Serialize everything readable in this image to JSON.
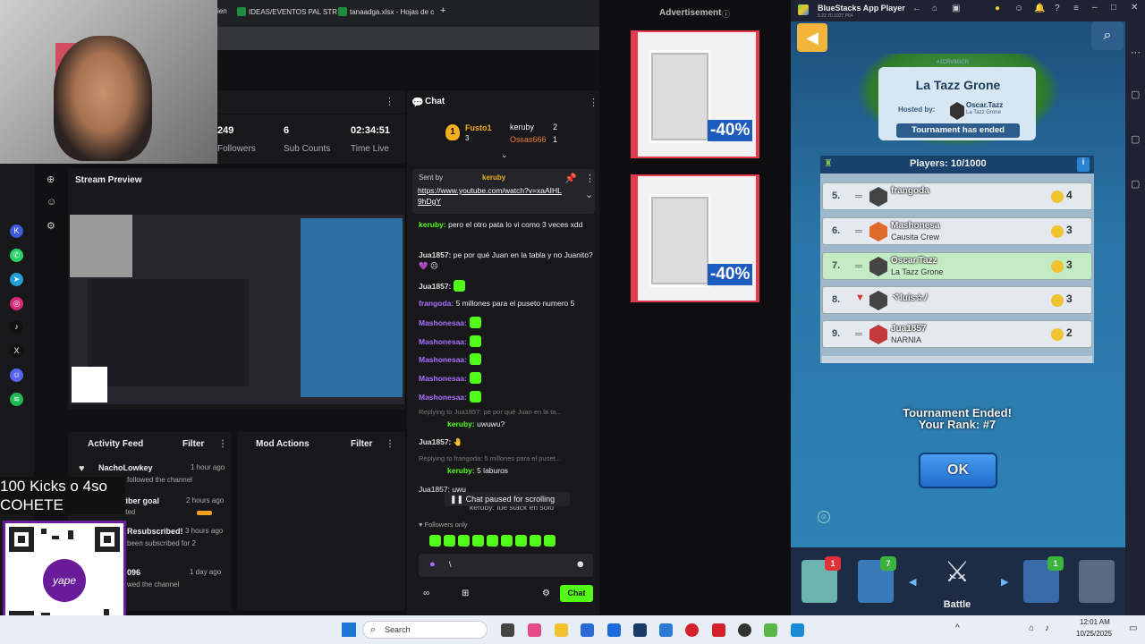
{
  "browser": {
    "tabs": [
      "IDEAS/EVENTOS PAL STR",
      "tanaadga.xlsx - Hojas de c"
    ],
    "partial_tab": "ien"
  },
  "dashboard": {
    "stats": [
      {
        "value": "249",
        "label": "Followers"
      },
      {
        "value": "6",
        "label": "Sub Counts"
      },
      {
        "value": "02:34:51",
        "label": "Time Live"
      }
    ],
    "stream_preview_title": "Stream Preview",
    "activity_title": "Activity Feed",
    "mod_title": "Mod Actions",
    "filter_label": "Filter",
    "feed": [
      {
        "name": "NachoLowkey",
        "time": "1 hour ago",
        "sub": "followed the channel"
      },
      {
        "name": "Subscriber goal",
        "time": "2 hours ago",
        "sub": "Just started"
      },
      {
        "name": "Resubscribed!",
        "time": "3 hours ago",
        "sub": "been subscribed for 2"
      },
      {
        "name": "096",
        "time": "1 day ago",
        "sub": "wed the channel"
      }
    ]
  },
  "overlay": {
    "kicks_line1": "100 Kicks o 4so",
    "kicks_line2": "COHETE"
  },
  "chat": {
    "title": "Chat",
    "top_gifters": [
      {
        "rank": "1",
        "name": "Fusto1",
        "count": "3"
      },
      {
        "name": "keruby",
        "count": "2"
      },
      {
        "name": "Ossas666",
        "count": "1"
      }
    ],
    "pinned_sender": "keruby",
    "pinned_prefix": "Sent by",
    "pinned_link": "https://www.youtube.com/watch?v=xaAIHL9hDgY",
    "messages": [
      {
        "name": "keruby:",
        "text": "pero el otro pata lo vi como 3 veces xdd"
      },
      {
        "name": "Jua1857:",
        "text": "pe por qué Juan en la tabla y no Juanito? 💜 ☹"
      },
      {
        "name": "Jua1857:",
        "text": ""
      },
      {
        "name": "frangoda:",
        "text": "5 millones para el puseto numero 5"
      },
      {
        "name": "Mashonesaa:",
        "text": ""
      },
      {
        "name": "Mashonesaa:",
        "text": ""
      },
      {
        "name": "Mashonesaa:",
        "text": ""
      },
      {
        "name": "Mashonesaa:",
        "text": ""
      },
      {
        "name": "Mashonesaa:",
        "text": ""
      }
    ],
    "reply1": "Replying to Jua1857: pe por qué Juan en la ta...",
    "msg_uwu": {
      "name": "keruby:",
      "text": "uwuwu?"
    },
    "msg_hand": {
      "name": "Jua1857:",
      "text": "🤚"
    },
    "reply2": "Replying to frangoda: 5 millones para el puset...",
    "msg_laburos": {
      "name": "keruby:",
      "text": "5 laburos"
    },
    "partial_msg": "Jua1857: uwu",
    "partial_msg2": "keruby: fue stack en solo",
    "paused": "Chat paused for scrolling",
    "followers_only": "Followers only",
    "input_value": "\\",
    "send_label": "Chat"
  },
  "ad": {
    "label": "Advertisement",
    "discount": "-40%"
  },
  "bluestacks": {
    "title": "BlueStacks App Player",
    "version": "5.22.70.1027  P64",
    "tag": "#2CRV8GCR",
    "tournament_name": "La Tazz Grone",
    "hosted_by_label": "Hosted by:",
    "host_name": "Oscar.Tazz",
    "host_clan": "La Tazz Grone",
    "status": "Tournament has ended",
    "players": "Players: 10/1000",
    "rows": [
      {
        "rank": "5.",
        "name": "frangoda",
        "clan": "",
        "trophies": "4"
      },
      {
        "rank": "6.",
        "name": "Mashonesa",
        "clan": "Causita Crew",
        "trophies": "3"
      },
      {
        "rank": "7.",
        "name": "Oscar.Tazz",
        "clan": "La Tazz Grone",
        "trophies": "3"
      },
      {
        "rank": "8.",
        "name": "ヾluis☆ﾉ",
        "clan": "",
        "trophies": "3"
      },
      {
        "rank": "9.",
        "name": "Jua1857",
        "clan": "NARNIA",
        "trophies": "2"
      }
    ],
    "ended_line1": "Tournament Ended!",
    "ended_line2": "Your Rank: #7",
    "ok_label": "OK",
    "battle_label": "Battle",
    "badge_shop": "1",
    "badge_cards": "7",
    "badge_clan": "1"
  },
  "taskbar": {
    "search_placeholder": "Search",
    "time": "12:01 AM",
    "date": "10/25/2025"
  }
}
